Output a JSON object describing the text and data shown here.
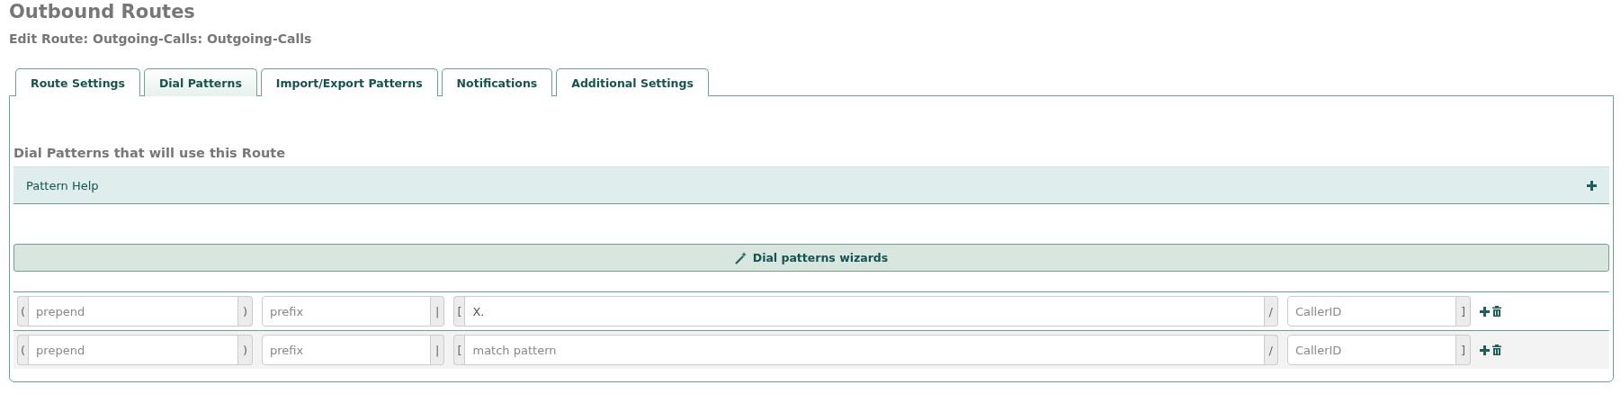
{
  "page": {
    "title": "Outbound Routes",
    "subtitle": "Edit Route: Outgoing-Calls: Outgoing-Calls"
  },
  "tabs": [
    {
      "label": "Route Settings",
      "selected": false
    },
    {
      "label": "Dial Patterns",
      "selected": true
    },
    {
      "label": "Import/Export Patterns",
      "selected": false
    },
    {
      "label": "Notifications",
      "selected": false
    },
    {
      "label": "Additional Settings",
      "selected": false
    }
  ],
  "section": {
    "heading": "Dial Patterns that will use this Route",
    "help": {
      "label": "Pattern Help",
      "expanded": false
    },
    "wizard": {
      "label": "Dial patterns wizards"
    }
  },
  "rows": [
    {
      "groups": [
        {
          "before": "(",
          "placeholder": "prepend",
          "after": ")"
        },
        {
          "placeholder": "prefix",
          "after": "|"
        },
        {
          "before": "[",
          "value": "X.",
          "after": "/"
        },
        {
          "placeholder": "CallerID",
          "after": "]"
        }
      ]
    },
    {
      "groups": [
        {
          "before": "(",
          "placeholder": "prepend",
          "after": ")"
        },
        {
          "placeholder": "prefix",
          "after": "|"
        },
        {
          "before": "[",
          "placeholder": "match pattern",
          "after": "/"
        },
        {
          "placeholder": "CallerID",
          "after": "]"
        }
      ]
    }
  ]
}
